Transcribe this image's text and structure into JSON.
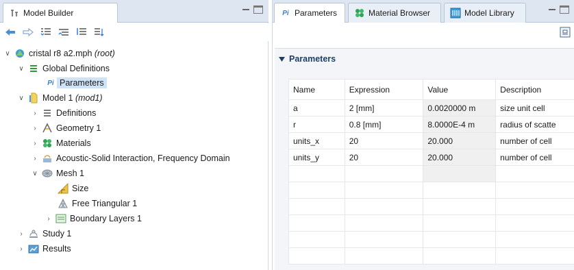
{
  "left_panel": {
    "tab_title": "Model Builder",
    "tree": [
      {
        "label": "cristal r8 a2.mph",
        "suffix": "(root)",
        "icon": "mph-file-icon"
      },
      {
        "label": "Global Definitions",
        "icon": "global-definitions-icon"
      },
      {
        "label": "Parameters",
        "icon": "parameters-icon",
        "selected": true
      },
      {
        "label": "Model 1",
        "suffix": "(mod1)",
        "icon": "model-icon"
      },
      {
        "label": "Definitions",
        "icon": "definitions-icon"
      },
      {
        "label": "Geometry 1",
        "icon": "geometry-icon"
      },
      {
        "label": "Materials",
        "icon": "materials-icon"
      },
      {
        "label": "Acoustic-Solid Interaction, Frequency Domain",
        "icon": "acoustic-solid-icon"
      },
      {
        "label": "Mesh 1",
        "icon": "mesh-icon"
      },
      {
        "label": "Size",
        "icon": "size-icon"
      },
      {
        "label": "Free Triangular 1",
        "icon": "free-triangular-icon"
      },
      {
        "label": "Boundary Layers 1",
        "icon": "boundary-layers-icon"
      },
      {
        "label": "Study 1",
        "icon": "study-icon"
      },
      {
        "label": "Results",
        "icon": "results-icon"
      }
    ]
  },
  "right_panel": {
    "tabs": [
      {
        "label": "Parameters",
        "icon_text": "Pi",
        "active": true
      },
      {
        "label": "Material Browser",
        "active": false
      },
      {
        "label": "Model Library",
        "active": false
      }
    ],
    "section_title": "Parameters",
    "table": {
      "headers": [
        "Name",
        "Expression",
        "Value",
        "Description"
      ],
      "rows": [
        [
          "a",
          "2 [mm]",
          "0.0020000 m",
          "size unit cell"
        ],
        [
          "r",
          "0.8 [mm]",
          "8.0000E-4 m",
          "radius of scatte"
        ],
        [
          "units_x",
          "20",
          "20.000",
          "number of cell"
        ],
        [
          "units_y",
          "20",
          "20.000",
          "number of cell"
        ]
      ]
    }
  },
  "icon_text": {
    "parameters": "Pi"
  }
}
